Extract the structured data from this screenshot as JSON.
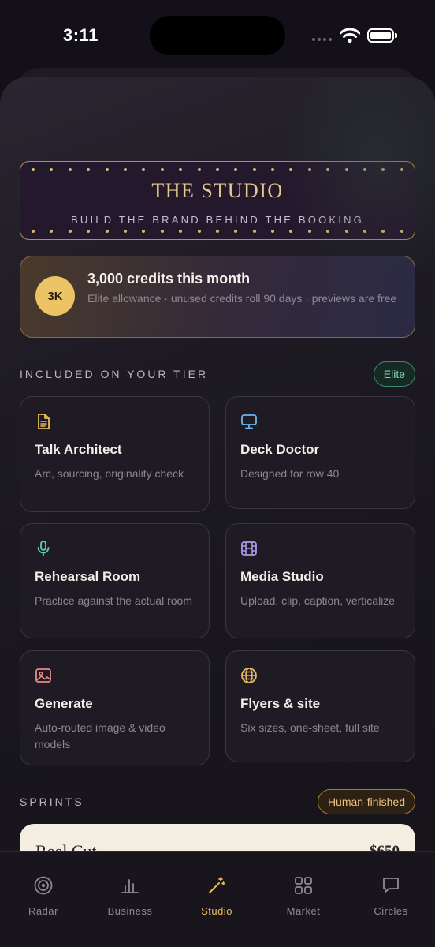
{
  "status_bar": {
    "time": "3:11"
  },
  "marquee": {
    "title": "THE STUDIO",
    "subtitle": "BUILD THE BRAND BEHIND THE BOOKING"
  },
  "credits": {
    "badge": "3K",
    "title": "3,000 credits this month",
    "subtitle": "Elite allowance · unused credits roll 90 days · previews are free"
  },
  "included": {
    "label": "INCLUDED ON YOUR TIER",
    "tier_badge": "Elite",
    "tools": [
      {
        "icon": "document-icon",
        "title": "Talk Architect",
        "desc": "Arc, sourcing, originality check"
      },
      {
        "icon": "monitor-icon",
        "title": "Deck Doctor",
        "desc": "Designed for row 40"
      },
      {
        "icon": "microphone-icon",
        "title": "Rehearsal Room",
        "desc": "Practice against the actual room"
      },
      {
        "icon": "film-icon",
        "title": "Media Studio",
        "desc": "Upload, clip, caption, verticalize"
      },
      {
        "icon": "image-icon",
        "title": "Generate",
        "desc": "Auto-routed image & video models"
      },
      {
        "icon": "globe-icon",
        "title": "Flyers & site",
        "desc": "Six sizes, one-sheet, full site"
      }
    ]
  },
  "sprints": {
    "label": "SPRINTS",
    "badge": "Human-finished",
    "items": [
      {
        "name": "Reel Cut",
        "price": "$650"
      }
    ]
  },
  "tabs": [
    {
      "label": "Radar",
      "icon": "radar-icon",
      "active": false
    },
    {
      "label": "Business",
      "icon": "bar-chart-icon",
      "active": false
    },
    {
      "label": "Studio",
      "icon": "magic-wand-icon",
      "active": true
    },
    {
      "label": "Market",
      "icon": "grid-icon",
      "active": false
    },
    {
      "label": "Circles",
      "icon": "chat-bubble-icon",
      "active": false
    }
  ],
  "colors": {
    "accent_gold": "#e8b960",
    "elite_green": "#7fd3b0",
    "background": "#141019",
    "card_bg": "#1f1b24"
  }
}
